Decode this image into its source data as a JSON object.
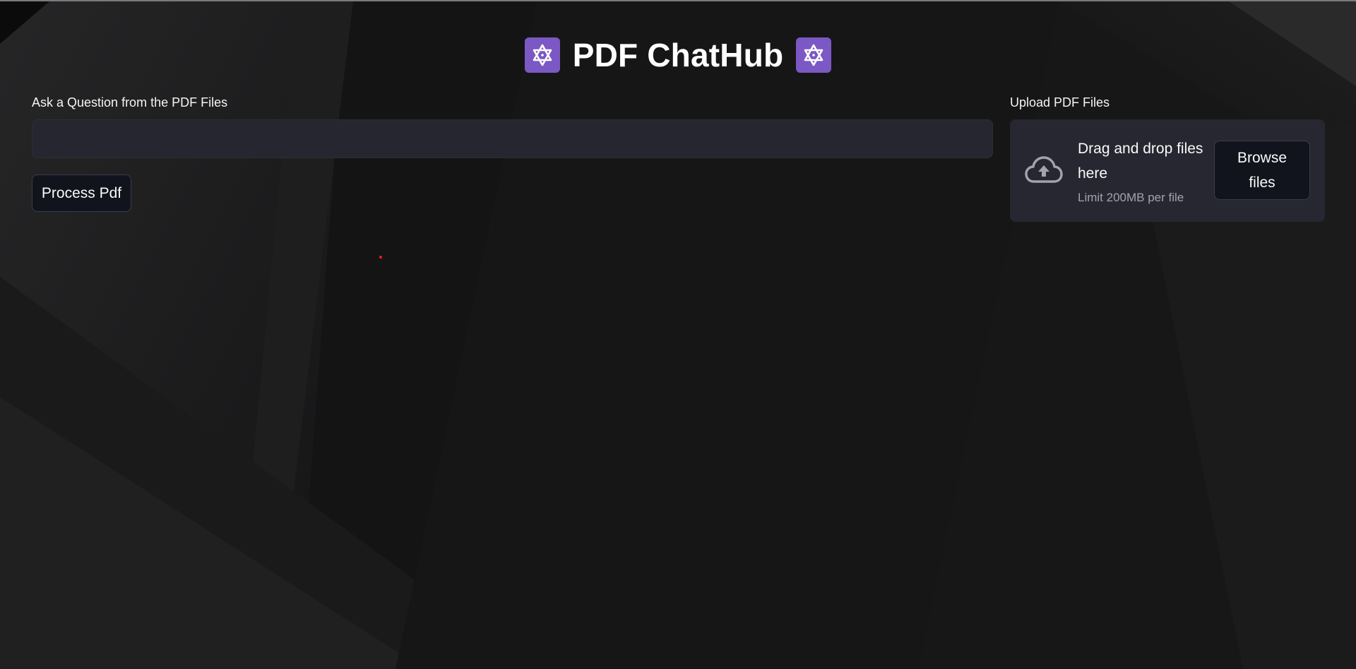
{
  "header": {
    "title": "PDF ChatHub",
    "left_icon": "star-of-david-icon",
    "right_icon": "star-of-david-icon",
    "icon_bg_color": "#7b58c4"
  },
  "question": {
    "label": "Ask a Question from the PDF Files",
    "value": "",
    "placeholder": ""
  },
  "process_button": {
    "label": "Process Pdf"
  },
  "upload": {
    "label": "Upload PDF Files",
    "drop_text": "Drag and drop files here",
    "limit_text": "Limit 200MB per file",
    "browse_label": "Browse files",
    "icon": "cloud-upload-icon"
  },
  "colors": {
    "background": "#151516",
    "input_bg": "#262630",
    "button_bg": "#11141c",
    "accent": "#7b58c4"
  }
}
